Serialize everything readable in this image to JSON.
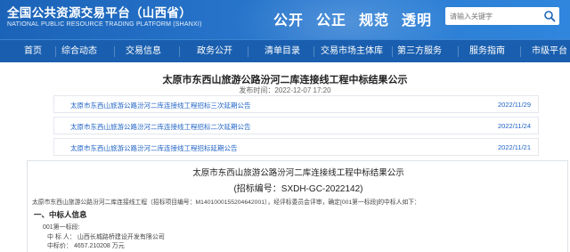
{
  "header": {
    "logo_cn": "全国公共资源交易平台（山西省）",
    "logo_en": "NATIONAL PUBLIC RESOURCE TRADING PLATFORM (SHANXI)",
    "slogans": [
      "公开",
      "公正",
      "规范",
      "透明"
    ],
    "search": {
      "placeholder": "请输入关键字",
      "icon": "search-icon"
    }
  },
  "nav": {
    "items": [
      "首页",
      "综合动态",
      "交易信息",
      "政务公开",
      "清单目录",
      "交易市场主体库",
      "第三方服务",
      "服务指南",
      "市级平台"
    ]
  },
  "article": {
    "title": "太原市东西山旅游公路汾河二库连接线工程中标结果公示",
    "publish_time": "发布时间：2022-12-07 17:20"
  },
  "related": [
    {
      "text": "太原市东西山旅游公路汾河二库连接线工程招标三次延期公告",
      "date": "2022/11/29"
    },
    {
      "text": "太原市东西山旅游公路汾河二库连接线工程招标二次延期公告",
      "date": "2022/11/24"
    },
    {
      "text": "太原市东西山旅游公路汾河二库连接线工程招标延期公告",
      "date": "2022/11/21"
    }
  ],
  "document": {
    "title": "太原市东西山旅游公路汾河二库连接线工程中标结果公示",
    "code": "(招标编号：SXDH-GC-2022142)",
    "intro": "太原市东西山旅游公路汾河二库连接线工程（招标项目编号：M1401000155204642001），经评标委员会评审，确定[001第一标段]的中标人如下：",
    "section1": "一、中标人信息",
    "lot": "001第一标段:",
    "winner_label": "中 标 人：",
    "winner_value": "山西长城路桥建设开发有限公司",
    "price_label": "中标价：",
    "price_value": "4657.210208 万元"
  },
  "colors": {
    "header_blue": "#1b63b8",
    "nav_blue": "#1a5faf",
    "link_blue": "#1f63c6"
  }
}
